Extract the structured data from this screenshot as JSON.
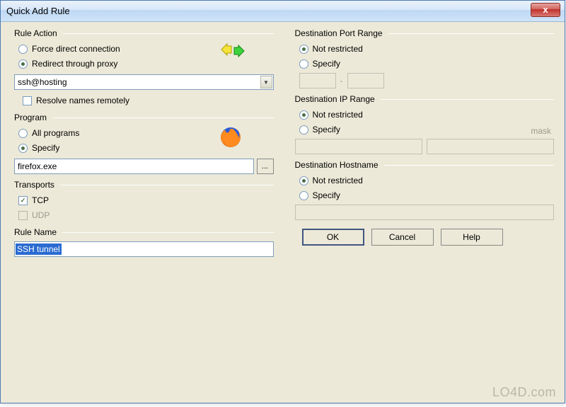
{
  "window": {
    "title": "Quick Add Rule"
  },
  "ruleAction": {
    "header": "Rule Action",
    "forceDirect": "Force direct connection",
    "redirect": "Redirect through proxy",
    "selected": "redirect",
    "proxy": "ssh@hosting",
    "resolveRemote": "Resolve names remotely",
    "resolveChecked": false
  },
  "program": {
    "header": "Program",
    "all": "All programs",
    "specify": "Specify",
    "selected": "specify",
    "value": "firefox.exe",
    "browse": "..."
  },
  "transports": {
    "header": "Transports",
    "tcp": "TCP",
    "tcpChecked": true,
    "udp": "UDP",
    "udpChecked": false
  },
  "ruleName": {
    "header": "Rule Name",
    "value": "SSH tunnel"
  },
  "portRange": {
    "header": "Destination Port Range",
    "notRestricted": "Not restricted",
    "specify": "Specify",
    "selected": "not",
    "from": "",
    "to": "",
    "sep": "-"
  },
  "ipRange": {
    "header": "Destination IP Range",
    "notRestricted": "Not restricted",
    "specify": "Specify",
    "selected": "not",
    "ip": "",
    "mask": "",
    "maskLabel": "mask"
  },
  "hostname": {
    "header": "Destination Hostname",
    "notRestricted": "Not restricted",
    "specify": "Specify",
    "selected": "not",
    "value": ""
  },
  "buttons": {
    "ok": "OK",
    "cancel": "Cancel",
    "help": "Help"
  },
  "watermark": "LO4D.com"
}
